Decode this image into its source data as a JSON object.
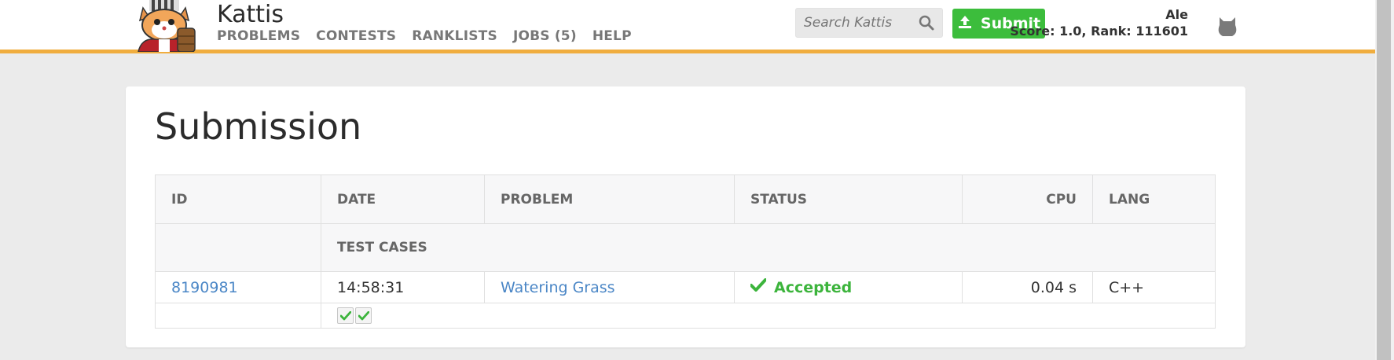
{
  "header": {
    "brand": "Kattis",
    "nav": [
      "PROBLEMS",
      "CONTESTS",
      "RANKLISTS",
      "JOBS (5)",
      "HELP"
    ],
    "search_placeholder": "Search Kattis",
    "submit_label": "Submit",
    "user_name": "Ale",
    "user_score": "Score: 1.0, Rank: 111601"
  },
  "page": {
    "title": "Submission"
  },
  "table": {
    "headers": [
      "ID",
      "DATE",
      "PROBLEM",
      "STATUS",
      "CPU",
      "LANG"
    ],
    "subheader": "TEST CASES",
    "row": {
      "id": "8190981",
      "date": "14:58:31",
      "problem": "Watering Grass",
      "status": "Accepted",
      "cpu": "0.04 s",
      "lang": "C++"
    },
    "test_cases": [
      "accepted",
      "accepted"
    ]
  },
  "colors": {
    "accent_orange": "#f0ad3e",
    "submit_green": "#3cbd3c",
    "accepted_green": "#3cb43c",
    "link_blue": "#4a86c6"
  }
}
